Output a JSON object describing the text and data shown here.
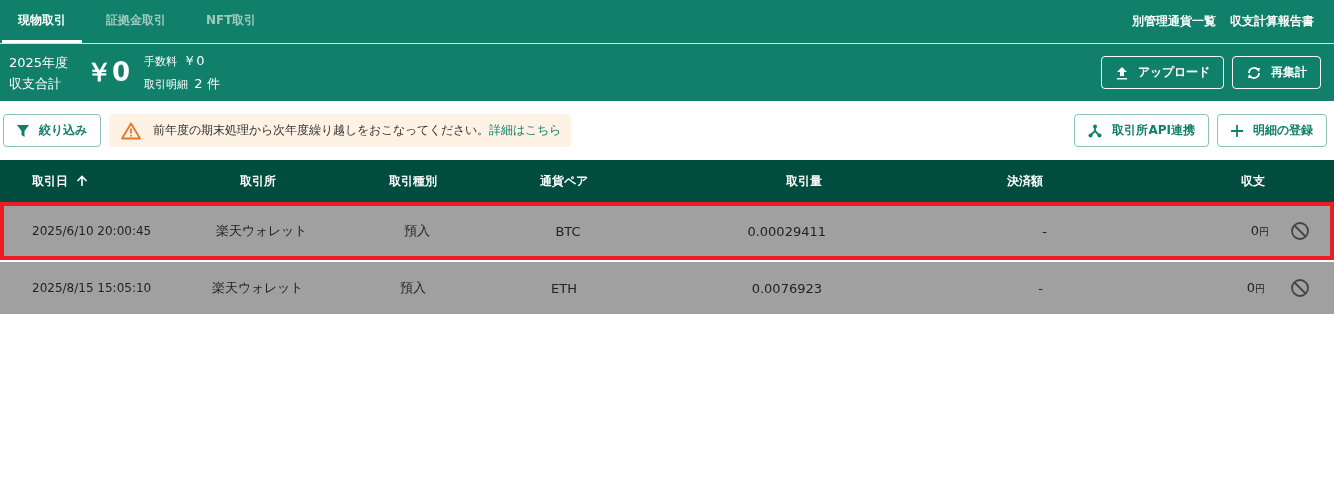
{
  "tabs": [
    {
      "label": "現物取引",
      "selected": true
    },
    {
      "label": "証拠金取引",
      "selected": false
    },
    {
      "label": "NFT取引",
      "selected": false
    }
  ],
  "header_links": [
    "別管理通貨一覧",
    "収支計算報告書"
  ],
  "summary": {
    "year": "2025年度",
    "label": "収支合計",
    "total": "￥0",
    "fee_label": "手数料",
    "fee": "￥0",
    "count_label": "取引明細",
    "count": "2 件"
  },
  "summary_buttons": [
    "アップロード",
    "再集計"
  ],
  "filter_button": "絞り込み",
  "notice": {
    "text": "前年度の期末処理から次年度繰り越しをおこなってください。",
    "link": "詳細はこちら"
  },
  "toolbar_buttons": [
    "取引所API連携",
    "明細の登録"
  ],
  "table": {
    "columns": [
      "取引日",
      "取引所",
      "取引種別",
      "通貨ペア",
      "取引量",
      "決済額",
      "収支"
    ],
    "rows": [
      {
        "selected": true,
        "cells": [
          "2025/6/10 20:00:45",
          "楽天ウォレット",
          "預入",
          "BTC",
          "0.00029411",
          "-"
        ],
        "amount": "0",
        "unit": "円"
      },
      {
        "selected": false,
        "cells": [
          "2025/8/15 15:05:10",
          "楽天ウォレット",
          "預入",
          "ETH",
          "0.0076923",
          "-"
        ],
        "amount": "0",
        "unit": "円"
      }
    ]
  }
}
